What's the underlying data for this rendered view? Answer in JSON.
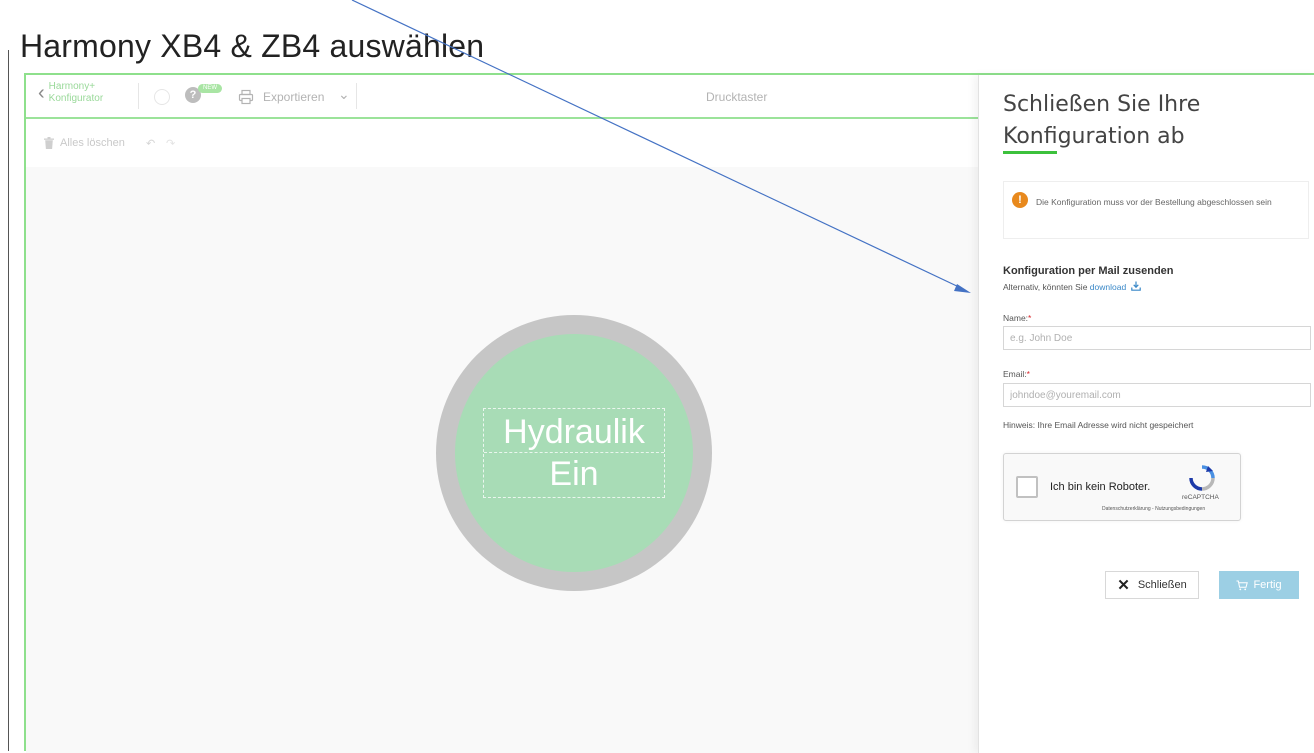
{
  "slide": {
    "title": "Harmony XB4 & ZB4 auswählen"
  },
  "toolbar": {
    "back_line1": "Harmony+",
    "back_line2": "Konfigurator",
    "help_badge": "NEW",
    "export_label": "Exportieren",
    "center_title": "Drucktaster"
  },
  "subbar": {
    "clear_label": "Alles löschen"
  },
  "preview": {
    "label_line1": "Hydraulik",
    "label_line2": "Ein"
  },
  "panel": {
    "title": "Schließen Sie Ihre Konfiguration ab",
    "alert_text": "Die Konfiguration muss vor der Bestellung abgeschlossen sein",
    "mail_heading": "Konfiguration per Mail zusenden",
    "alt_text": "Alternativ, könnten Sie",
    "download_label": "download",
    "name_label": "Name:",
    "name_placeholder": "e.g. John Doe",
    "email_label": "Email:",
    "email_placeholder": "johndoe@youremail.com",
    "required_mark": "*",
    "hint": "Hinweis: Ihre Email Adresse wird nicht gespeichert",
    "captcha_label": "Ich bin kein Roboter.",
    "captcha_brand": "reCAPTCHA",
    "captcha_terms": "Datenschutzerklärung - Nutzungsbedingungen",
    "close_label": "Schließen",
    "done_label": "Fertig"
  },
  "colors": {
    "accent_green": "#3cc13c",
    "frame_green": "#8ee08c",
    "alert_orange": "#e8891d",
    "done_blue": "#9ccfe4",
    "arrow_blue": "#4472c4"
  }
}
